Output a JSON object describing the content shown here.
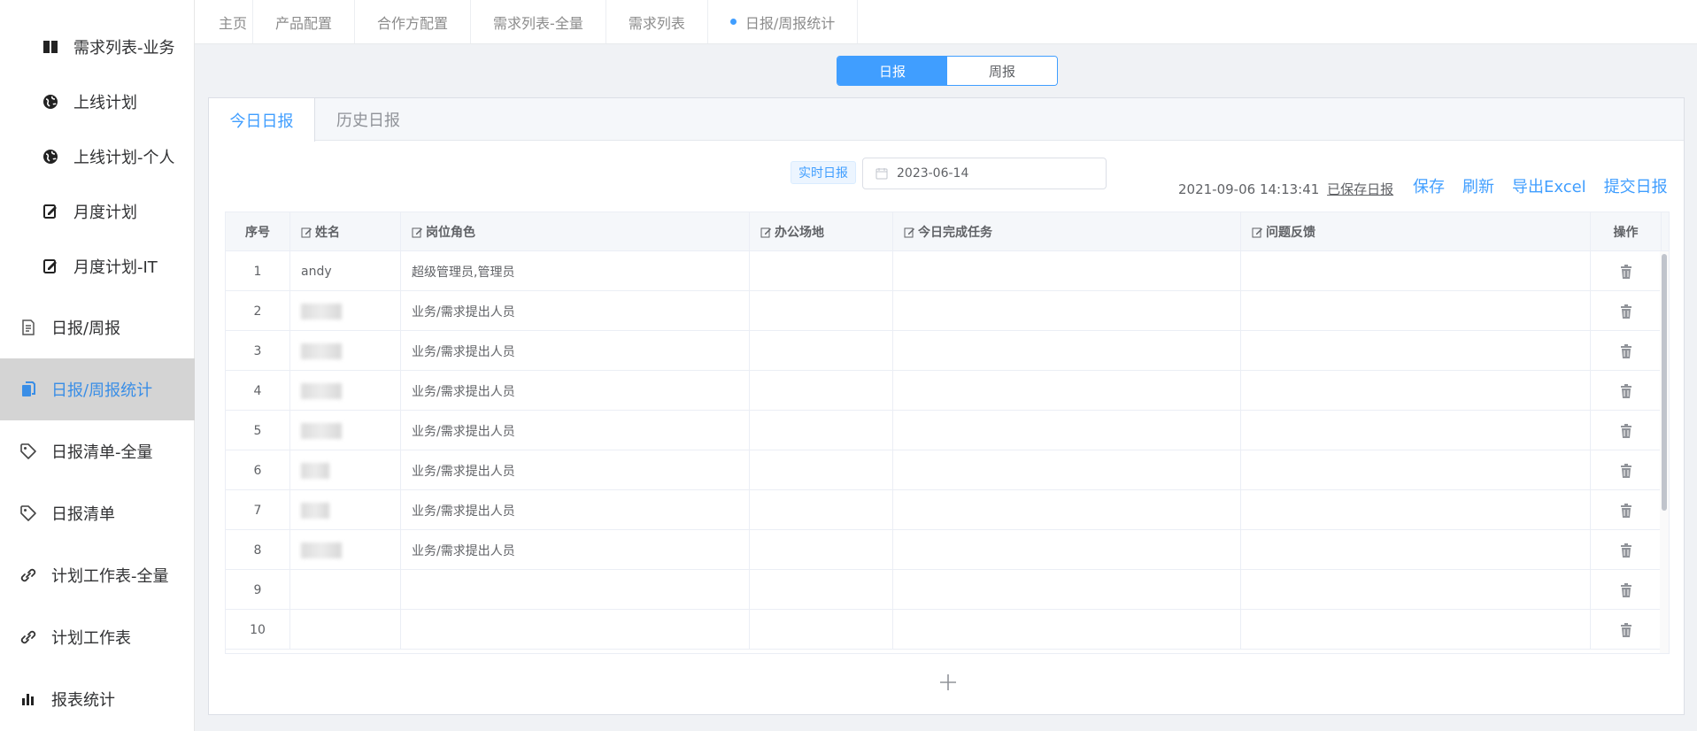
{
  "sidebar": {
    "items": [
      {
        "label": "需求列表-业务",
        "icon": "book-icon"
      },
      {
        "label": "上线计划",
        "icon": "globe-icon"
      },
      {
        "label": "上线计划-个人",
        "icon": "globe-icon"
      },
      {
        "label": "月度计划",
        "icon": "edit-document-icon"
      },
      {
        "label": "月度计划-IT",
        "icon": "edit-document-icon"
      },
      {
        "label": "日报/周报",
        "icon": "document-icon"
      },
      {
        "label": "日报/周报统计",
        "icon": "copy-document-icon",
        "active": true
      },
      {
        "label": "日报清单-全量",
        "icon": "tag-icon"
      },
      {
        "label": "日报清单",
        "icon": "tag-icon"
      },
      {
        "label": "计划工作表-全量",
        "icon": "link-icon"
      },
      {
        "label": "计划工作表",
        "icon": "link-icon"
      },
      {
        "label": "报表统计",
        "icon": "bar-chart-icon"
      }
    ]
  },
  "tags": [
    "主页",
    "产品配置",
    "合作方配置",
    "需求列表-全量",
    "需求列表",
    "日报/周报统计"
  ],
  "toggle": {
    "daily": "日报",
    "weekly": "周报"
  },
  "card_tabs": {
    "today": "今日日报",
    "history": "历史日报"
  },
  "filter": {
    "badge": "实时日报",
    "date": "2023-06-14"
  },
  "saved": {
    "time": "2021-09-06 14:13:41",
    "link": "已保存日报"
  },
  "actions": {
    "save": "保存",
    "refresh": "刷新",
    "export": "导出Excel",
    "submit": "提交日报"
  },
  "table": {
    "headers": [
      "序号",
      "姓名",
      "岗位角色",
      "办公场地",
      "今日完成任务",
      "问题反馈",
      "操作"
    ],
    "rows": [
      {
        "no": "1",
        "name": "andy",
        "role": "超级管理员,管理员"
      },
      {
        "no": "2",
        "name": "",
        "role": "业务/需求提出人员"
      },
      {
        "no": "3",
        "name": "",
        "role": "业务/需求提出人员"
      },
      {
        "no": "4",
        "name": "",
        "role": "业务/需求提出人员"
      },
      {
        "no": "5",
        "name": "",
        "role": "业务/需求提出人员"
      },
      {
        "no": "6",
        "name": "",
        "role": "业务/需求提出人员"
      },
      {
        "no": "7",
        "name": "",
        "role": "业务/需求提出人员"
      },
      {
        "no": "8",
        "name": "",
        "role": "业务/需求提出人员"
      },
      {
        "no": "9",
        "name": "",
        "role": ""
      },
      {
        "no": "10",
        "name": "",
        "role": ""
      }
    ]
  },
  "colors": {
    "accent": "#409eff",
    "active_bg": "#d4d4d4"
  }
}
